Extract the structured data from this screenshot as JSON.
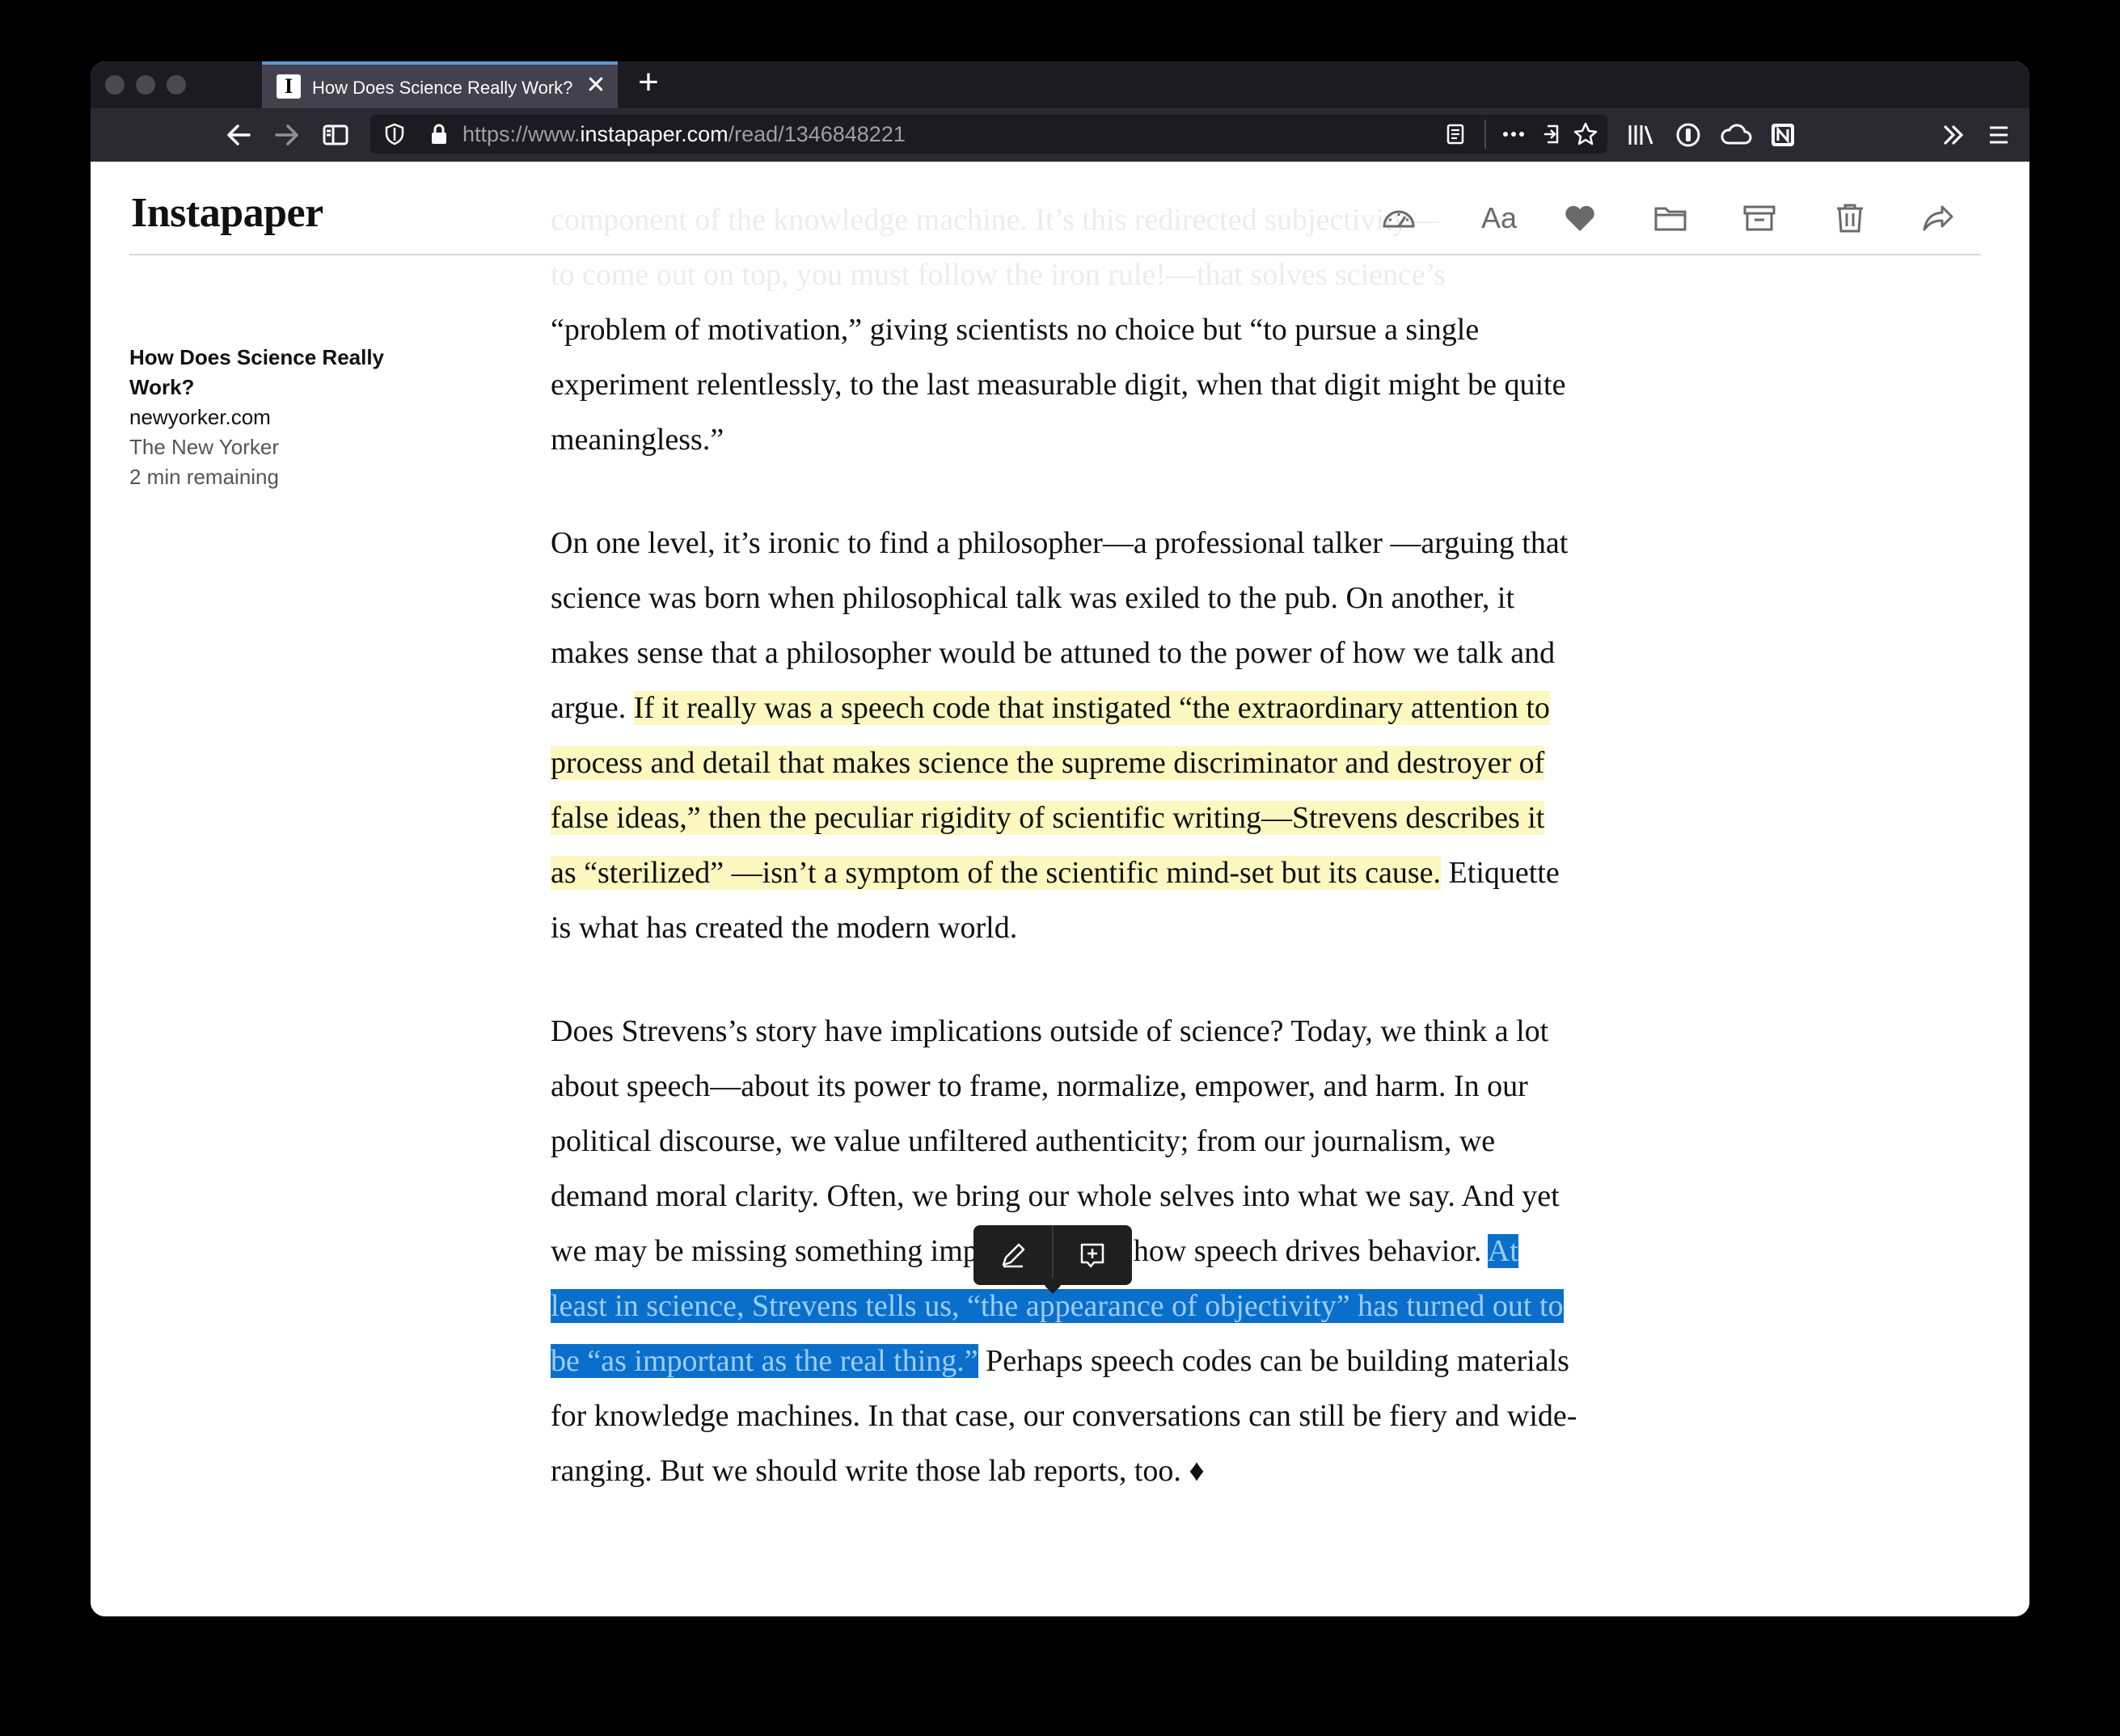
{
  "browser": {
    "tab_title": "How Does Science Really Work?",
    "tab_favicon": "I",
    "url_prefix": "https://www.",
    "url_host": "instapaper.com",
    "url_path": "/read/1346848221"
  },
  "app": {
    "logo": "Instapaper",
    "toolbar_icons": [
      "speed-reading-icon",
      "text-settings-icon",
      "like-heart-icon",
      "move-folder-icon",
      "archive-icon",
      "delete-trash-icon",
      "share-icon"
    ],
    "text_settings_label": "Aa"
  },
  "meta": {
    "title": "How Does Science Really Work?",
    "domain": "newyorker.com",
    "publication": "The New Yorker",
    "time_remaining": "2 min remaining"
  },
  "article": {
    "p0": {
      "faded_line1": "component of the knowledge machine. It’s this redirected subjectivity—",
      "faded_line2": "to come out on top, you must follow the iron rule!—that solves science’s",
      "text": "“problem of motivation,” giving scientists no choice but “to pursue a single experiment relentlessly, to the last measurable digit, when that digit might be quite meaningless.”"
    },
    "p1": {
      "before": "On one level, it’s ironic to find a philosopher—a professional talker —arguing that science was born when philosophical talk was exiled to the pub. On another, it makes sense that a philosopher would be attuned to the power of how we talk and argue. ",
      "highlight": "If it really was a speech code that instigated “the extraordinary attention to process and detail that makes science the supreme discriminator and destroyer of false ideas,” then the peculiar rigidity of scientific writing—Strevens describes it as “sterilized” —isn’t a symptom of the scientific mind-set but its cause.",
      "after": " Etiquette is what has created the modern world."
    },
    "p2": {
      "before": "Does Strevens’s story have implications outside of science? Today, we think a lot about speech—about its power to frame, normalize, empower, and harm. In our political discourse, we value unfiltered authenticity; from our journalism, we demand moral clarity. Often, we bring our whole selves into what we say. And yet we may be missing something important about how speech drives behavior. ",
      "selected": "At least in science, Strevens tells us, “the appearance of objectivity” has turned out to be “as important as the real thing.”",
      "after": " Perhaps speech codes can be building materials for knowledge machines. In that case, our conversations can still be fiery and wide-ranging. But we should write those lab reports, too. ♦"
    }
  },
  "popover": {
    "actions": [
      "highlight-pen-icon",
      "add-note-icon"
    ]
  },
  "colors": {
    "highlight_yellow": "#fdf7c0",
    "selection_blue": "#0a6fcb",
    "tab_accent": "#5b9bd5"
  }
}
